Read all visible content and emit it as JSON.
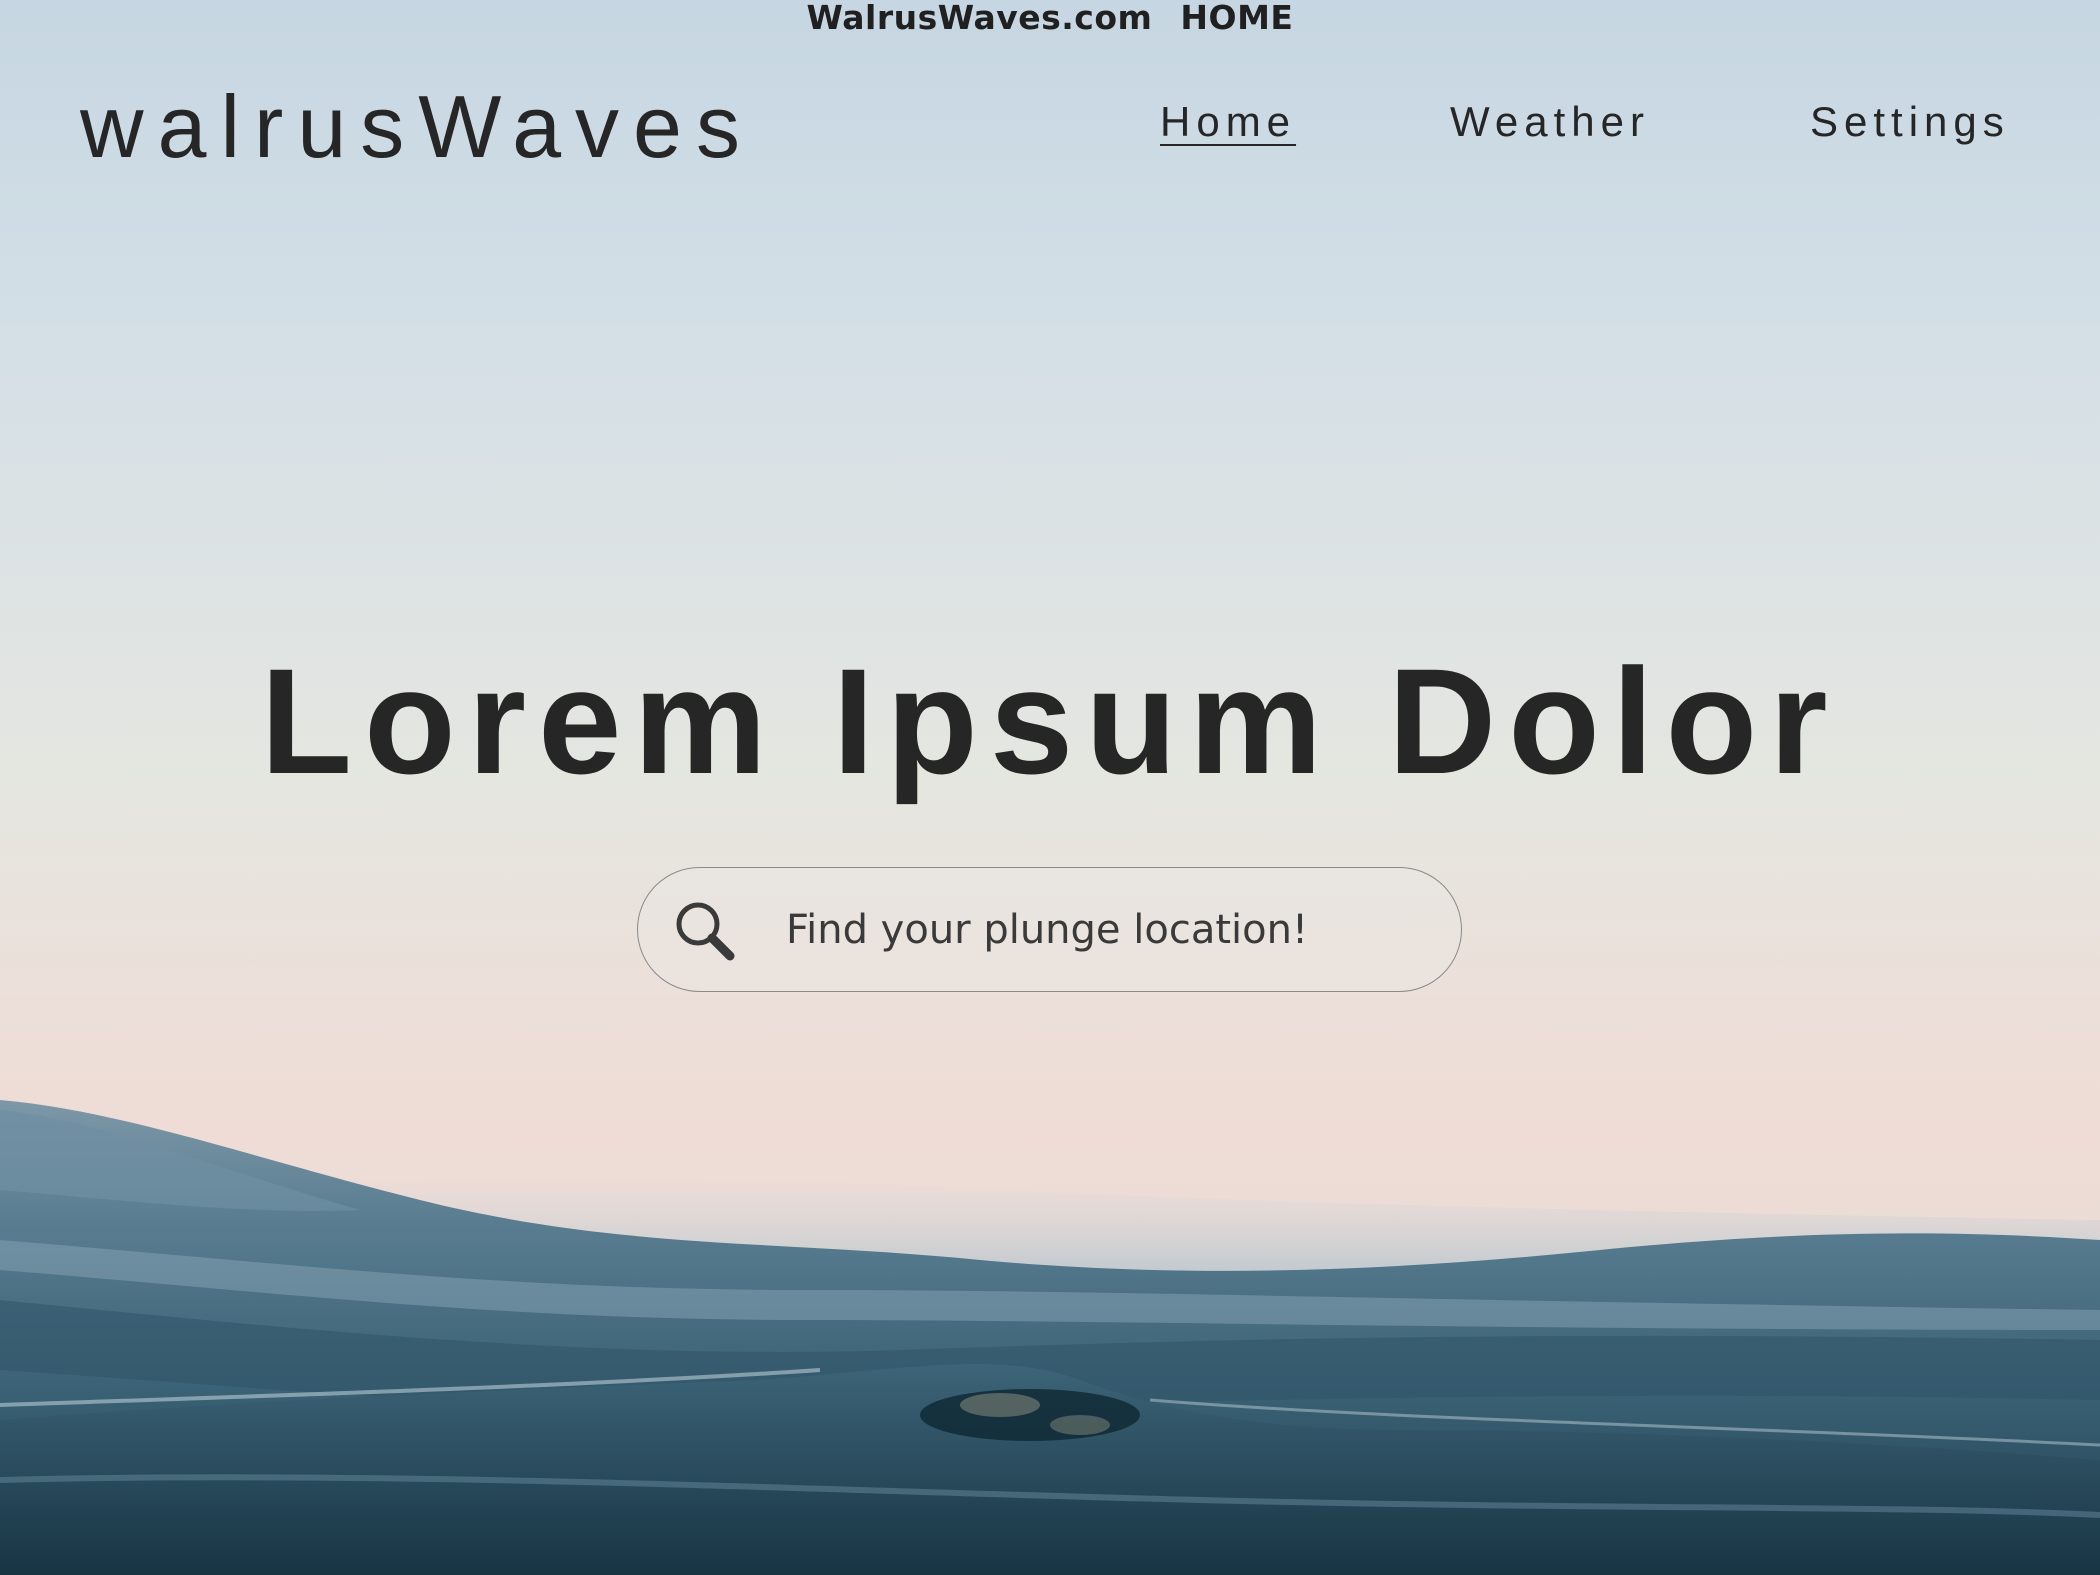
{
  "browser": {
    "site": "WalrusWaves.com",
    "page": "HOME"
  },
  "header": {
    "logo": "walrusWaves",
    "nav": [
      {
        "label": "Home",
        "active": true
      },
      {
        "label": "Weather",
        "active": false
      },
      {
        "label": "Settings",
        "active": false
      }
    ]
  },
  "hero": {
    "title": "Lorem Ipsum Dolor"
  },
  "search": {
    "placeholder": "Find your plunge location!",
    "value": "",
    "icon": "search-icon"
  },
  "colors": {
    "text": "#262626",
    "sky_top": "#c6d6e2",
    "sky_horizon": "#efdcd6",
    "sea": "#2e5468"
  }
}
